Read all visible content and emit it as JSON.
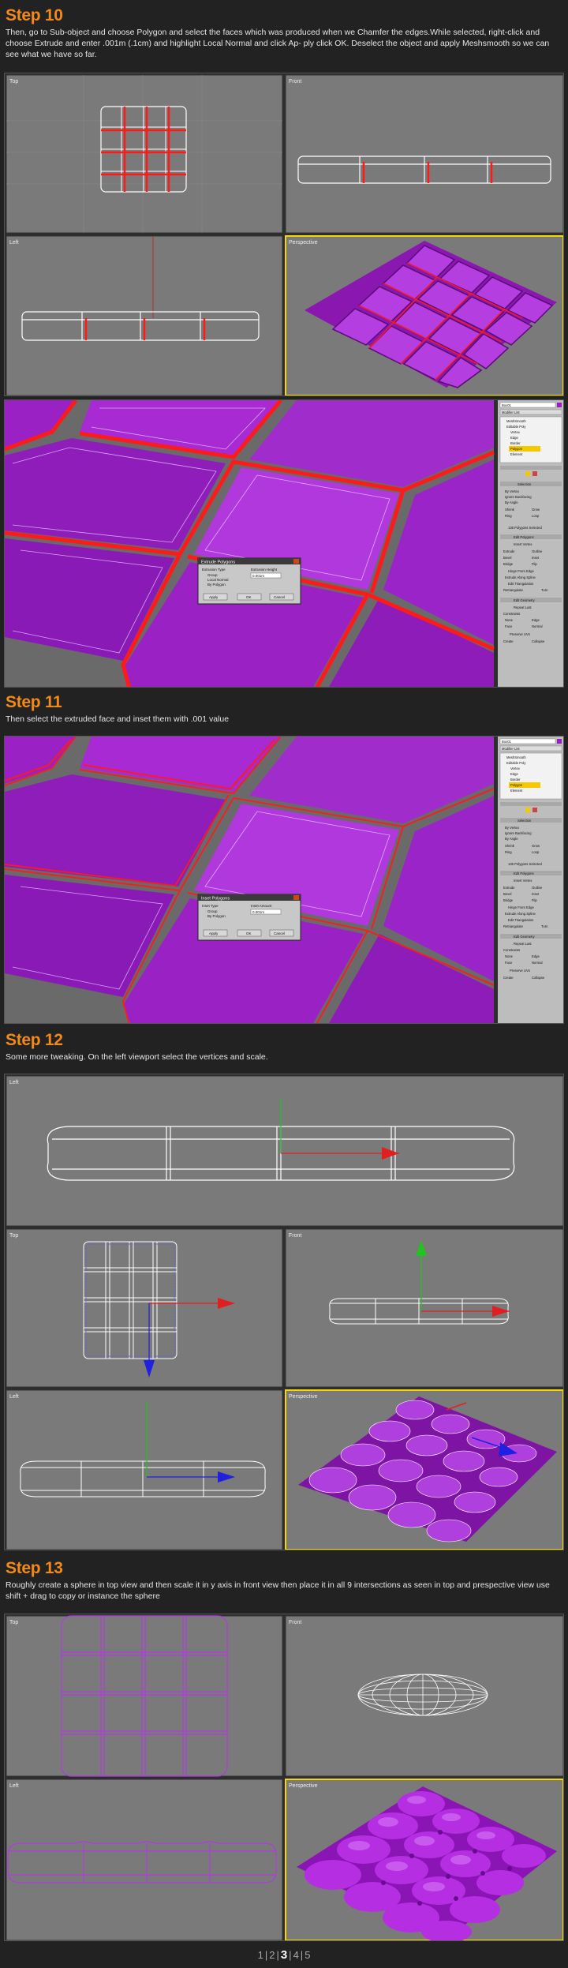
{
  "steps": [
    {
      "heading": "Step 10",
      "text": "Then, go to Sub-object and choose Polygon and select the faces which was produced when we Chamfer the edges.While selected, right-click and choose Extrude and enter .001m (.1cm) and highlight Local Normal and click Ap- ply click OK. Deselect the object and apply Meshsmooth so we can see what we have so far."
    },
    {
      "heading": "Step 11",
      "text": "Then select the extruded face and inset them with .001 value"
    },
    {
      "heading": "Step 12",
      "text": "Some more tweaking. On the left viewport select the vertices and scale."
    },
    {
      "heading": "Step 13",
      "text": "Roughly create a sphere in top view and then scale it in y axis in front view then place it in all 9 intersections as seen in top and prespective view use shift + drag to copy or instance the sphere"
    }
  ],
  "dialogs": {
    "extrude": {
      "title": "Extrude Polygons",
      "group1": "Extrusion Type",
      "opt1": "Group",
      "opt2": "Local Normal",
      "opt3": "By Polygon",
      "group2": "Extrusion Height",
      "value": "0.001m",
      "apply": "Apply",
      "ok": "OK",
      "cancel": "Cancel"
    },
    "inset": {
      "title": "Inset Polygons",
      "group1": "Inset Type",
      "opt1": "Group",
      "opt2": "By Polygon",
      "group2": "Inset Amount",
      "value": "0.001m",
      "apply": "Apply",
      "ok": "OK",
      "cancel": "Cancel"
    }
  },
  "viewport_labels": {
    "top": "Top",
    "front": "Front",
    "left": "Left",
    "perspective": "Perspective"
  },
  "panel": {
    "object_name": "Box01",
    "modifier_list": "Modifier List",
    "stack": [
      "MeshSmooth",
      "Editable Poly",
      "Vertex",
      "Edge",
      "Border",
      "Polygon",
      "Element"
    ],
    "selection": "Selection",
    "by_vertex": "By Vertex",
    "ignore_backfacing": "Ignore Backfacing",
    "by_angle": "By Angle",
    "shrink": "Shrink",
    "grow": "Grow",
    "ring": "Ring",
    "loop": "Loop",
    "status": "136 Polygons Selected",
    "edit_polygons": "Edit Polygons",
    "insert_vertex": "Insert Vertex",
    "extrude": "Extrude",
    "outline": "Outline",
    "bevel": "Bevel",
    "inset": "Inset",
    "bridge": "Bridge",
    "flip": "Flip",
    "hinge": "Hinge From Edge",
    "extrude_spline": "Extrude Along Spline",
    "edit_tri": "Edit Triangulation",
    "retriangulate": "Retriangulate",
    "turn": "Turn",
    "edit_geometry": "Edit Geometry",
    "repeat_last": "Repeat Last",
    "constraints": "Constraints",
    "none": "None",
    "edge": "Edge",
    "face": "Face",
    "normal": "Normal",
    "preserve_uvs": "Preserve UVs",
    "create": "Create",
    "collapse": "Collapse"
  },
  "pager": {
    "items": [
      "1",
      "2",
      "3",
      "4",
      "5"
    ],
    "current": "3"
  },
  "colors": {
    "accent": "#f28a1a",
    "viewport_bg": "#7a7a7a",
    "active_border": "#f5d800",
    "mesh_purple": "#9b1fc0",
    "selection_red": "#ff1a1a"
  }
}
